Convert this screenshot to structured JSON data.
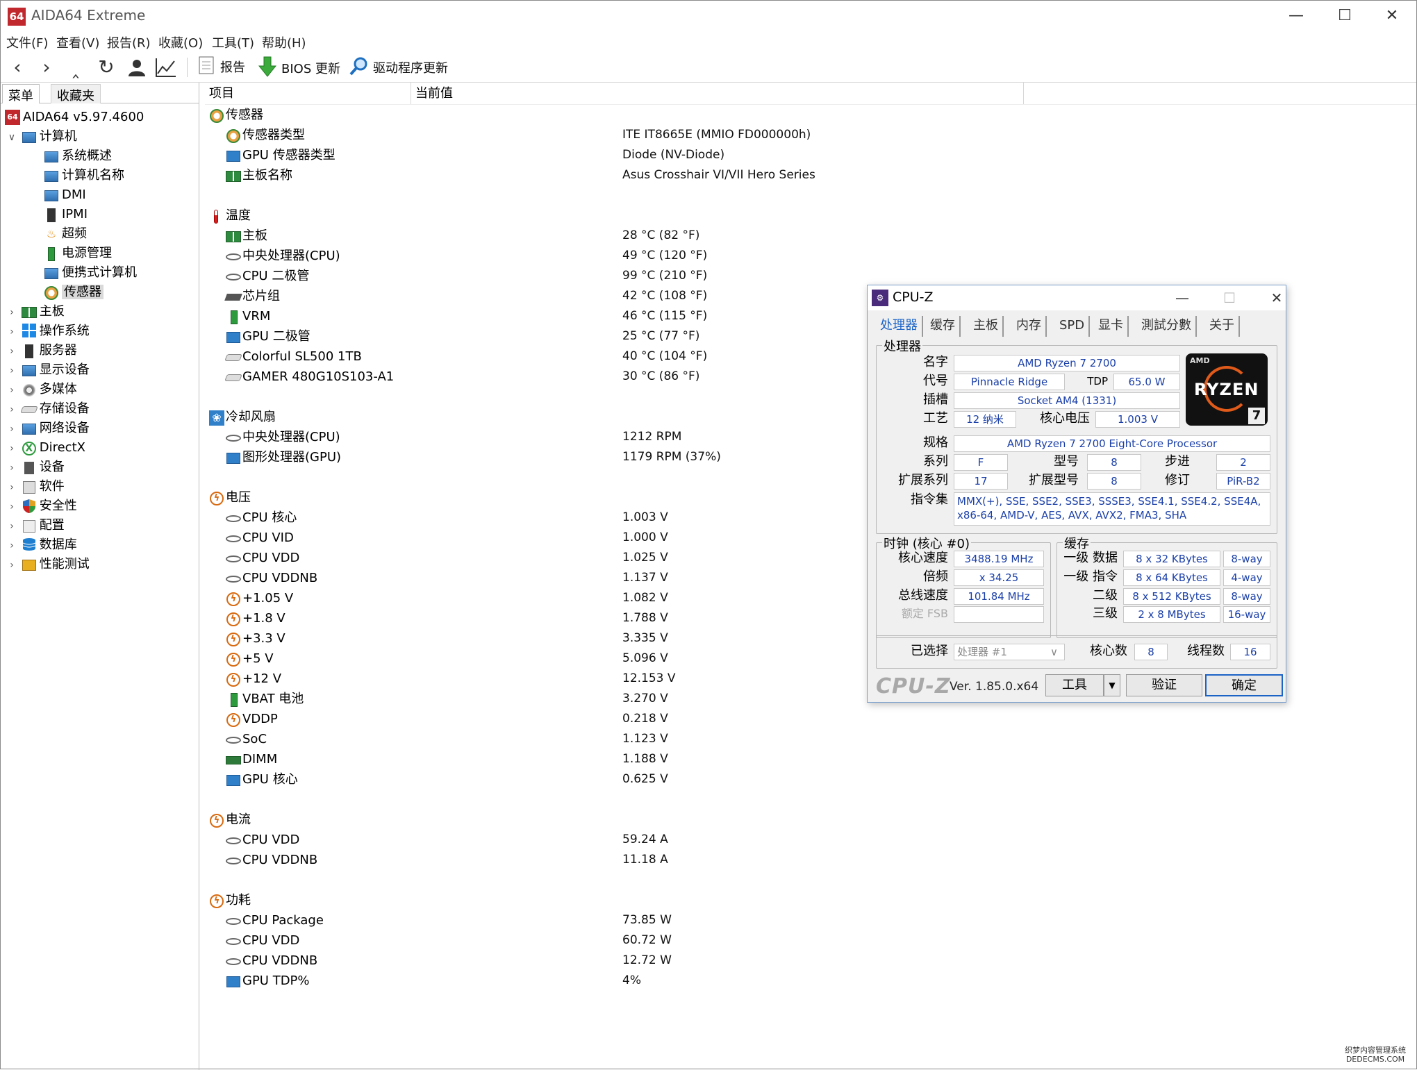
{
  "app": {
    "logo": "64",
    "title": "AIDA64 Extreme",
    "controls": {
      "minimize": "—",
      "maximize": "☐",
      "close": "✕"
    }
  },
  "menu": [
    "文件(F)",
    "查看(V)",
    "报告(R)",
    "收藏(O)",
    "工具(T)",
    "帮助(H)"
  ],
  "toolbar": {
    "icons": [
      "chevron-left-icon",
      "chevron-right-icon",
      "chevron-up-icon",
      "refresh-icon",
      "user-icon",
      "chart-icon"
    ],
    "report": "报告",
    "bios": "BIOS 更新",
    "driver": "驱动程序更新"
  },
  "left_tabs": {
    "menu": "菜单",
    "favorites": "收藏夹"
  },
  "tree": {
    "root": "AIDA64 v5.97.4600",
    "computer": "计算机",
    "computer_children": [
      "系统概述",
      "计算机名称",
      "DMI",
      "IPMI",
      "超频",
      "电源管理",
      "便携式计算机",
      "传感器"
    ],
    "top": [
      "主板",
      "操作系统",
      "服务器",
      "显示设备",
      "多媒体",
      "存储设备",
      "网络设备",
      "DirectX",
      "设备",
      "软件",
      "安全性",
      "配置",
      "数据库",
      "性能测试"
    ]
  },
  "columns": {
    "item": "项目",
    "value": "当前值"
  },
  "sections": {
    "sensor": {
      "title": "传感器",
      "rows": [
        {
          "name": "传感器类型",
          "value": "ITE IT8665E  (MMIO FD000000h)"
        },
        {
          "name": "GPU 传感器类型",
          "value": "Diode  (NV-Diode)"
        },
        {
          "name": "主板名称",
          "value": "Asus Crosshair VI/VII Hero Series"
        }
      ]
    },
    "temperature": {
      "title": "温度",
      "rows": [
        {
          "name": "主板",
          "value": "28 °C  (82 °F)"
        },
        {
          "name": "中央处理器(CPU)",
          "value": "49 °C  (120 °F)"
        },
        {
          "name": "CPU 二极管",
          "value": "99 °C  (210 °F)"
        },
        {
          "name": "芯片组",
          "value": "42 °C  (108 °F)"
        },
        {
          "name": "VRM",
          "value": "46 °C  (115 °F)"
        },
        {
          "name": "GPU 二极管",
          "value": "25 °C  (77 °F)"
        },
        {
          "name": "Colorful SL500 1TB",
          "value": "40 °C  (104 °F)"
        },
        {
          "name": "GAMER 480G10S103-A1",
          "value": "30 °C  (86 °F)"
        }
      ]
    },
    "fan": {
      "title": "冷却风扇",
      "rows": [
        {
          "name": "中央处理器(CPU)",
          "value": "1212 RPM"
        },
        {
          "name": "图形处理器(GPU)",
          "value": "1179 RPM  (37%)"
        }
      ]
    },
    "voltage": {
      "title": "电压",
      "rows": [
        {
          "name": "CPU 核心",
          "value": "1.003 V"
        },
        {
          "name": "CPU VID",
          "value": "1.000 V"
        },
        {
          "name": "CPU VDD",
          "value": "1.025 V"
        },
        {
          "name": "CPU VDDNB",
          "value": "1.137 V"
        },
        {
          "name": "+1.05 V",
          "value": "1.082 V"
        },
        {
          "name": "+1.8 V",
          "value": "1.788 V"
        },
        {
          "name": "+3.3 V",
          "value": "3.335 V"
        },
        {
          "name": "+5 V",
          "value": "5.096 V"
        },
        {
          "name": "+12 V",
          "value": "12.153 V"
        },
        {
          "name": "VBAT 电池",
          "value": "3.270 V"
        },
        {
          "name": "VDDP",
          "value": "0.218 V"
        },
        {
          "name": "SoC",
          "value": "1.123 V"
        },
        {
          "name": "DIMM",
          "value": "1.188 V"
        },
        {
          "name": "GPU 核心",
          "value": "0.625 V"
        }
      ]
    },
    "current": {
      "title": "电流",
      "rows": [
        {
          "name": "CPU VDD",
          "value": "59.24 A"
        },
        {
          "name": "CPU VDDNB",
          "value": "11.18 A"
        }
      ]
    },
    "power": {
      "title": "功耗",
      "rows": [
        {
          "name": "CPU Package",
          "value": "73.85 W"
        },
        {
          "name": "CPU VDD",
          "value": "60.72 W"
        },
        {
          "name": "CPU VDDNB",
          "value": "12.72 W"
        },
        {
          "name": "GPU TDP%",
          "value": "4%"
        }
      ]
    }
  },
  "cpuz": {
    "title": "CPU-Z",
    "tabs": [
      "处理器",
      "缓存",
      "主板",
      "内存",
      "SPD",
      "显卡",
      "測試分數",
      "关于"
    ],
    "processor_group": "处理器",
    "labels": {
      "name": "名字",
      "codename": "代号",
      "tdp": "TDP",
      "socket": "插槽",
      "tech": "工艺",
      "core_voltage": "核心电压",
      "spec": "规格",
      "family": "系列",
      "model": "型号",
      "stepping": "步进",
      "ext_family": "扩展系列",
      "ext_model": "扩展型号",
      "revision": "修订",
      "instructions": "指令集"
    },
    "values": {
      "name": "AMD Ryzen 7 2700",
      "codename": "Pinnacle Ridge",
      "tdp": "65.0 W",
      "socket": "Socket AM4 (1331)",
      "tech": "12 纳米",
      "core_voltage": "1.003 V",
      "spec": "AMD Ryzen 7 2700 Eight-Core Processor",
      "family": "F",
      "model": "8",
      "stepping": "2",
      "ext_family": "17",
      "ext_model": "8",
      "revision": "PiR-B2",
      "instructions": "MMX(+), SSE, SSE2, SSE3, SSSE3, SSE4.1, SSE4.2, SSE4A, x86-64, AMD-V, AES, AVX, AVX2, FMA3, SHA"
    },
    "logo": {
      "brand": "AMD",
      "text": "RYZEN",
      "tier": "7"
    },
    "clocks_group": "时钟 (核心 #0)",
    "clocks": {
      "core_speed_label": "核心速度",
      "core_speed": "3488.19 MHz",
      "multiplier_label": "倍频",
      "multiplier": "x 34.25",
      "bus_speed_label": "总线速度",
      "bus_speed": "101.84 MHz",
      "rated_fsb_label": "额定 FSB",
      "rated_fsb": ""
    },
    "cache_group": "缓存",
    "cache": [
      {
        "label": "一级 数据",
        "size": "8 x 32 KBytes",
        "way": "8-way"
      },
      {
        "label": "一级 指令",
        "size": "8 x 64 KBytes",
        "way": "4-way"
      },
      {
        "label": "二级",
        "size": "8 x 512 KBytes",
        "way": "8-way"
      },
      {
        "label": "三级",
        "size": "2 x 8 MBytes",
        "way": "16-way"
      }
    ],
    "selection": {
      "selected_label": "已选择",
      "selected": "处理器 #1",
      "cores_label": "核心数",
      "cores": "8",
      "threads_label": "线程数",
      "threads": "16"
    },
    "bottom": {
      "brand": "CPU-Z",
      "version": "Ver. 1.85.0.x64",
      "tools": "工具",
      "tools_arrow": "▼",
      "validate": "验证",
      "ok": "确定"
    },
    "controls": {
      "minimize": "—",
      "maximize": "☐",
      "close": "✕"
    }
  },
  "watermark": {
    "line1": "织梦内容管理系统",
    "line2": "DEDECMS.COM"
  }
}
